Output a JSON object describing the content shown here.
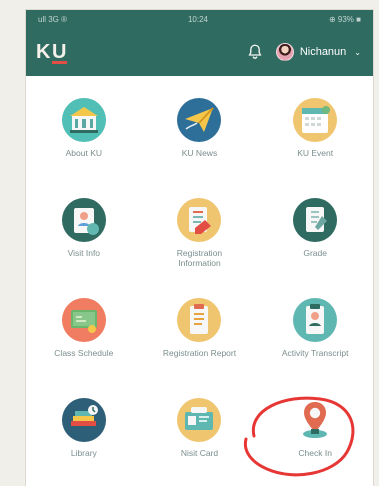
{
  "status": {
    "left": "ull 3G ®",
    "time": "10:24",
    "right": "⊕ 93% ■"
  },
  "header": {
    "logo_k": "K",
    "logo_u": "U",
    "user_name": "Nichanun"
  },
  "menu": [
    {
      "label": "About KU",
      "icon": "about"
    },
    {
      "label": "KU News",
      "icon": "news"
    },
    {
      "label": "KU Event",
      "icon": "event"
    },
    {
      "label": "Visit Info",
      "icon": "visit"
    },
    {
      "label": "Registration Information",
      "icon": "registration-info"
    },
    {
      "label": "Grade",
      "icon": "grade"
    },
    {
      "label": "Class Schedule",
      "icon": "schedule"
    },
    {
      "label": "Registration Report",
      "icon": "report"
    },
    {
      "label": "Activity Transcript",
      "icon": "transcript"
    },
    {
      "label": "Library",
      "icon": "library"
    },
    {
      "label": "Nisit Card",
      "icon": "card"
    },
    {
      "label": "Check In",
      "icon": "check-in"
    }
  ],
  "colors": {
    "header": "#2f6b61",
    "accent_red": "#e34e44",
    "label_text": "#7a8e8d",
    "icon_teal": "#1f6d67"
  }
}
